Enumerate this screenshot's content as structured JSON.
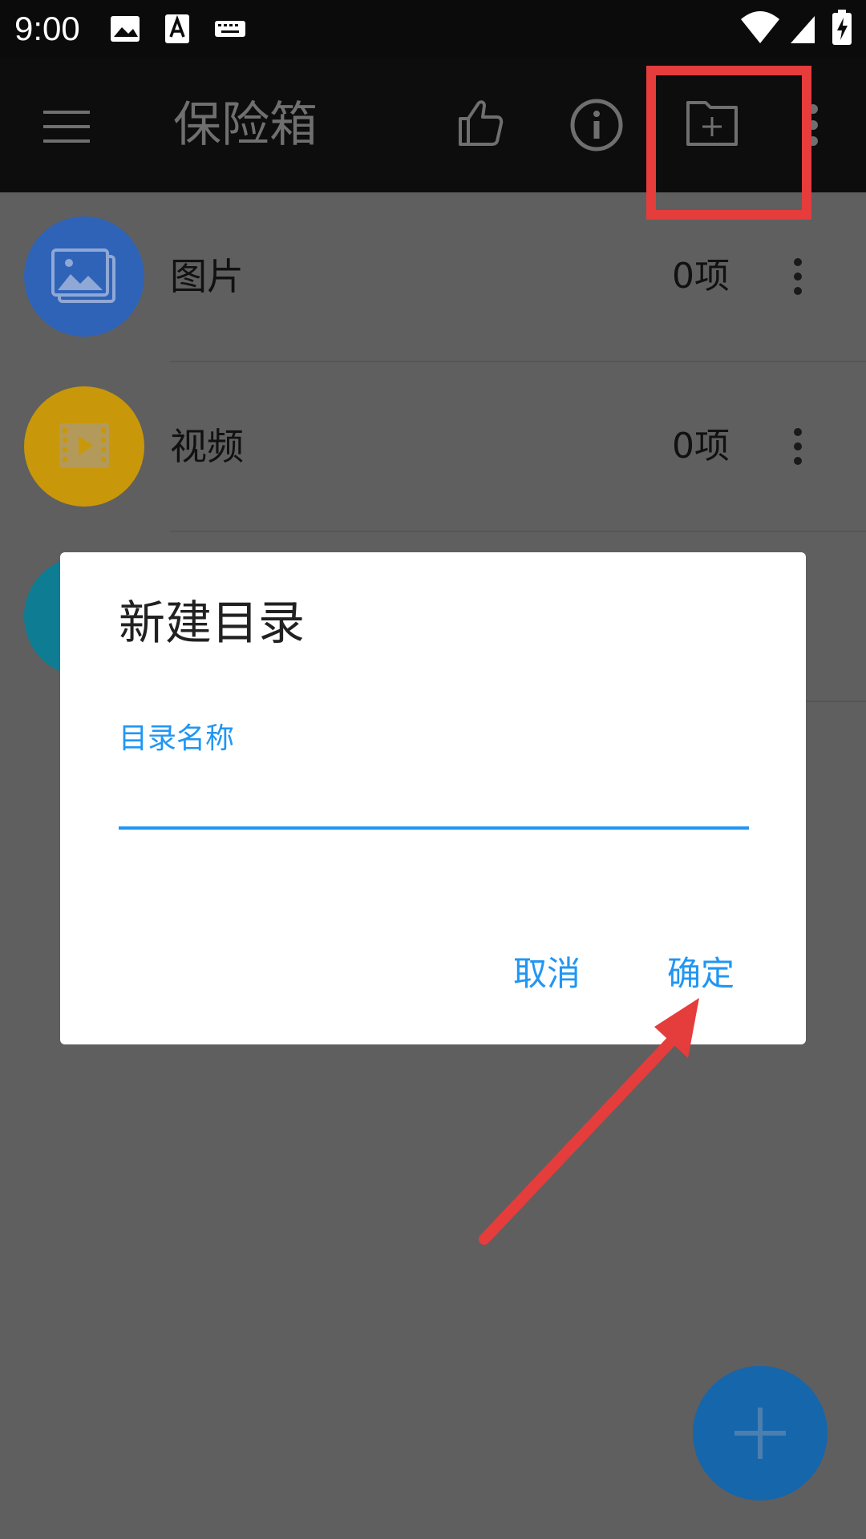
{
  "status_bar": {
    "time": "9:00",
    "icons": [
      "image-icon",
      "text-a-icon",
      "keyboard-icon",
      "wifi-icon",
      "signal-icon",
      "battery-charging-icon"
    ]
  },
  "app_bar": {
    "title": "保险箱",
    "icons": [
      "menu-icon",
      "thumbs-up-icon",
      "info-icon",
      "new-folder-icon",
      "more-vertical-icon"
    ]
  },
  "list": {
    "items": [
      {
        "label": "图片",
        "count": "0项",
        "icon": "image-icon",
        "color": "#2f63b8"
      },
      {
        "label": "视频",
        "count": "0项",
        "icon": "video-icon",
        "color": "#c9970a"
      },
      {
        "label": "",
        "count": "",
        "icon": "",
        "color": "#0e7d93"
      }
    ]
  },
  "dialog": {
    "title": "新建目录",
    "field_label": "目录名称",
    "field_value": "",
    "cancel_label": "取消",
    "ok_label": "确定"
  },
  "fab": {
    "icon": "plus-icon"
  },
  "colors": {
    "accent": "#2196f3",
    "annotation": "#e53c3c",
    "scrim_background": "#5f5f5f"
  }
}
